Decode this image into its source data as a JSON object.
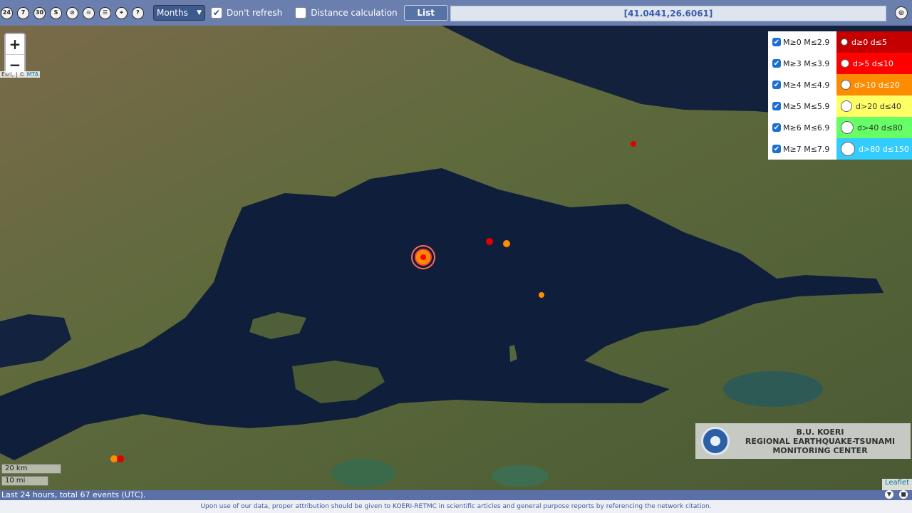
{
  "toolbar": {
    "icons": [
      {
        "label": "24",
        "name": "last-24h-icon"
      },
      {
        "label": "7",
        "name": "last-7days-icon"
      },
      {
        "label": "30",
        "name": "last-30days-icon"
      },
      {
        "label": "S",
        "name": "search-icon"
      },
      {
        "label": "⊘",
        "name": "no-filter-icon"
      },
      {
        "label": "☠",
        "name": "fault-lines-icon"
      },
      {
        "label": "☰",
        "name": "list-view-icon"
      },
      {
        "label": "⌖",
        "name": "locate-icon"
      },
      {
        "label": "?",
        "name": "help-icon"
      }
    ],
    "period_select": "Months",
    "dont_refresh_label": "Don't refresh",
    "dont_refresh_checked": "✔",
    "distance_label": "Distance calculation",
    "list_button": "List",
    "coordinates": "[41.0441,26.6061]",
    "menu_icon": "⊜"
  },
  "map": {
    "zoom_in": "+",
    "zoom_out": "−",
    "attribution_prefix": "Esri, | © ",
    "attribution_link": "MTA",
    "scale_km": "20 km",
    "scale_mi": "10 mi",
    "leaflet_attribution": "Leaflet"
  },
  "legend": {
    "magnitudes": [
      {
        "label": "M≥0  M≤2.9",
        "checked": "✔"
      },
      {
        "label": "M≥3  M≤3.9",
        "checked": "✔"
      },
      {
        "label": "M≥4  M≤4.9",
        "checked": "✔"
      },
      {
        "label": "M≥5  M≤5.9",
        "checked": "✔"
      },
      {
        "label": "M≥6  M≤6.9",
        "checked": "✔"
      },
      {
        "label": "M≥7  M≤7.9",
        "checked": "✔"
      }
    ],
    "depths": [
      {
        "label": "d≥0  d≤5",
        "color": "#c40000",
        "text_color": "#ffffff"
      },
      {
        "label": "d>5  d≤10",
        "color": "#ff0000",
        "text_color": "#ffffff"
      },
      {
        "label": "d>10  d≤20",
        "color": "#ff8c00",
        "text_color": "#ffffff"
      },
      {
        "label": "d>20  d≤40",
        "color": "#ffff66",
        "text_color": "#333333"
      },
      {
        "label": "d>40  d≤80",
        "color": "#66ff66",
        "text_color": "#333333"
      },
      {
        "label": "d>80  d≤150",
        "color": "#33ccff",
        "text_color": "#ffffff"
      }
    ]
  },
  "logo": {
    "line1": "B.U. KOERI",
    "line2": "REGIONAL EARTHQUAKE-TSUNAMI",
    "line3": "MONITORING CENTER"
  },
  "status": {
    "summary": "Last 24 hours, total 67 events (UTC).",
    "footer": "Upon use of our data, proper attribution should be given to KOERI-RETMC in scientific articles and general purpose reports by referencing the network citation."
  },
  "colors": {
    "toolbar": "#6a7fae",
    "sea": "#0f1e3a",
    "land": "#5b6b3e"
  }
}
